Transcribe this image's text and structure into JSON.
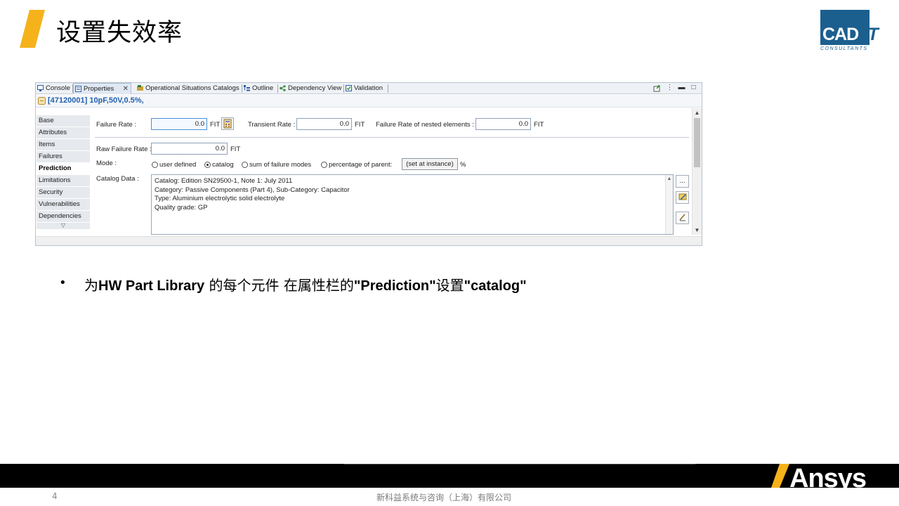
{
  "slide": {
    "title": "设置失效率",
    "page_number": "4",
    "company": "新科益系统与咨询（上海）有限公司"
  },
  "logos": {
    "cadit_main": "CAD",
    "cadit_it": "-IT",
    "cadit_sub": "CONSULTANTS",
    "ansys": "Ansys"
  },
  "colors": {
    "accent_yellow": "#f5b21b",
    "cadit_blue": "#1b5f8f",
    "title_blue": "#2060b0"
  },
  "tabs": [
    {
      "label": "Console",
      "icon": "console-icon"
    },
    {
      "label": "Properties",
      "icon": "properties-icon",
      "active": true
    },
    {
      "label": "Operational Situations Catalogs",
      "icon": "catalog-icon"
    },
    {
      "label": "Outline",
      "icon": "outline-icon"
    },
    {
      "label": "Dependency View",
      "icon": "dependency-icon"
    },
    {
      "label": "Validation",
      "icon": "validation-icon"
    }
  ],
  "element_title": "[47120001] 10pF,50V,0.5%,",
  "sidebar": {
    "items": [
      "Base",
      "Attributes",
      "Items",
      "Failures",
      "Prediction",
      "Limitations",
      "Security",
      "Vulnerabilities",
      "Dependencies"
    ],
    "active": "Prediction"
  },
  "prediction": {
    "failure_rate_label": "Failure Rate :",
    "failure_rate_value": "0.0",
    "transient_rate_label": "Transient Rate :",
    "transient_rate_value": "0.0",
    "nested_rate_label": "Failure Rate of nested elements :",
    "nested_rate_value": "0.0",
    "raw_failure_rate_label": "Raw Failure Rate :",
    "raw_failure_rate_value": "0.0",
    "unit": "FIT",
    "mode_label": "Mode :",
    "modes": [
      "user defined",
      "catalog",
      "sum of failure modes",
      "percentage of parent:"
    ],
    "selected_mode": "catalog",
    "set_at_instance": "(set at instance)",
    "percent_unit": "%",
    "catalog_data_label": "Catalog Data :",
    "catalog_lines": [
      "Catalog: Edition SN29500-1, Note 1: July 2011",
      "Category: Passive Components (Part 4), Sub-Category: Capacitor",
      "Type: Aluminium electrolytic solid electrolyte",
      "Quality grade: GP"
    ],
    "browse_label": "..."
  },
  "bullet": {
    "part1": "为",
    "part2": "HW Part Library",
    "part3": " 的每个元件 在属性栏的",
    "part4": "\"Prediction\"",
    "part5": "设置",
    "part6": "\"catalog\""
  }
}
